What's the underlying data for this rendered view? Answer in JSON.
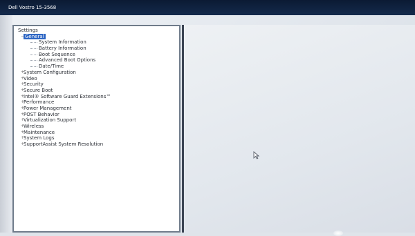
{
  "window": {
    "title": "Dell Vostro 15-3568"
  },
  "tree": {
    "root": "Settings",
    "general": {
      "label": "General",
      "children": [
        "System Information",
        "Battery Information",
        "Boot Sequence",
        "Advanced Boot Options",
        "Date/Time"
      ]
    },
    "groups": [
      "System Configuration",
      "Video",
      "Security",
      "Secure Boot",
      "Intel® Software Guard Extensions™",
      "Performance",
      "Power Management",
      "POST Behavior",
      "Virtualization Support",
      "Wireless",
      "Maintenance",
      "System Logs",
      "SupportAssist System Resolution"
    ]
  },
  "icons": {
    "cursor": "mouse-pointer-icon",
    "expander": "plus-expander-icon"
  },
  "colors": {
    "selection": "#2e66c4",
    "panel_border": "#6f7b8a"
  }
}
